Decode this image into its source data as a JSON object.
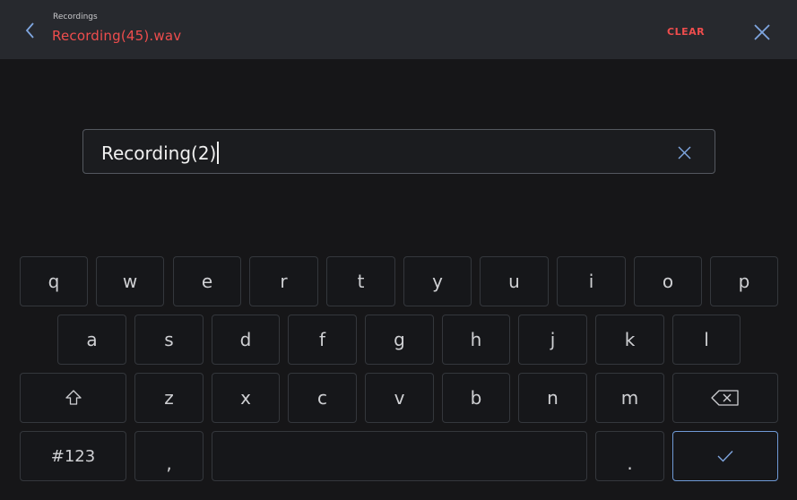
{
  "header": {
    "breadcrumb": "Recordings",
    "title": "Recording(45).wav",
    "clear_label": "CLEAR",
    "accent_color": "#ef4d4d",
    "back_icon": "chevron-left-icon",
    "close_icon": "close-icon"
  },
  "input": {
    "value": "Recording(2)",
    "clear_icon": "close-icon"
  },
  "keyboard": {
    "row1": [
      "q",
      "w",
      "e",
      "r",
      "t",
      "y",
      "u",
      "i",
      "o",
      "p"
    ],
    "row2": [
      "a",
      "s",
      "d",
      "f",
      "g",
      "h",
      "j",
      "k",
      "l"
    ],
    "row3": [
      "z",
      "x",
      "c",
      "v",
      "b",
      "n",
      "m"
    ],
    "symbols_label": "#123",
    "comma_label": ",",
    "period_label": ".",
    "shift_icon": "shift-icon",
    "backspace_icon": "backspace-icon",
    "enter_icon": "checkmark-icon",
    "enter_border_color": "#6f9ad6"
  }
}
